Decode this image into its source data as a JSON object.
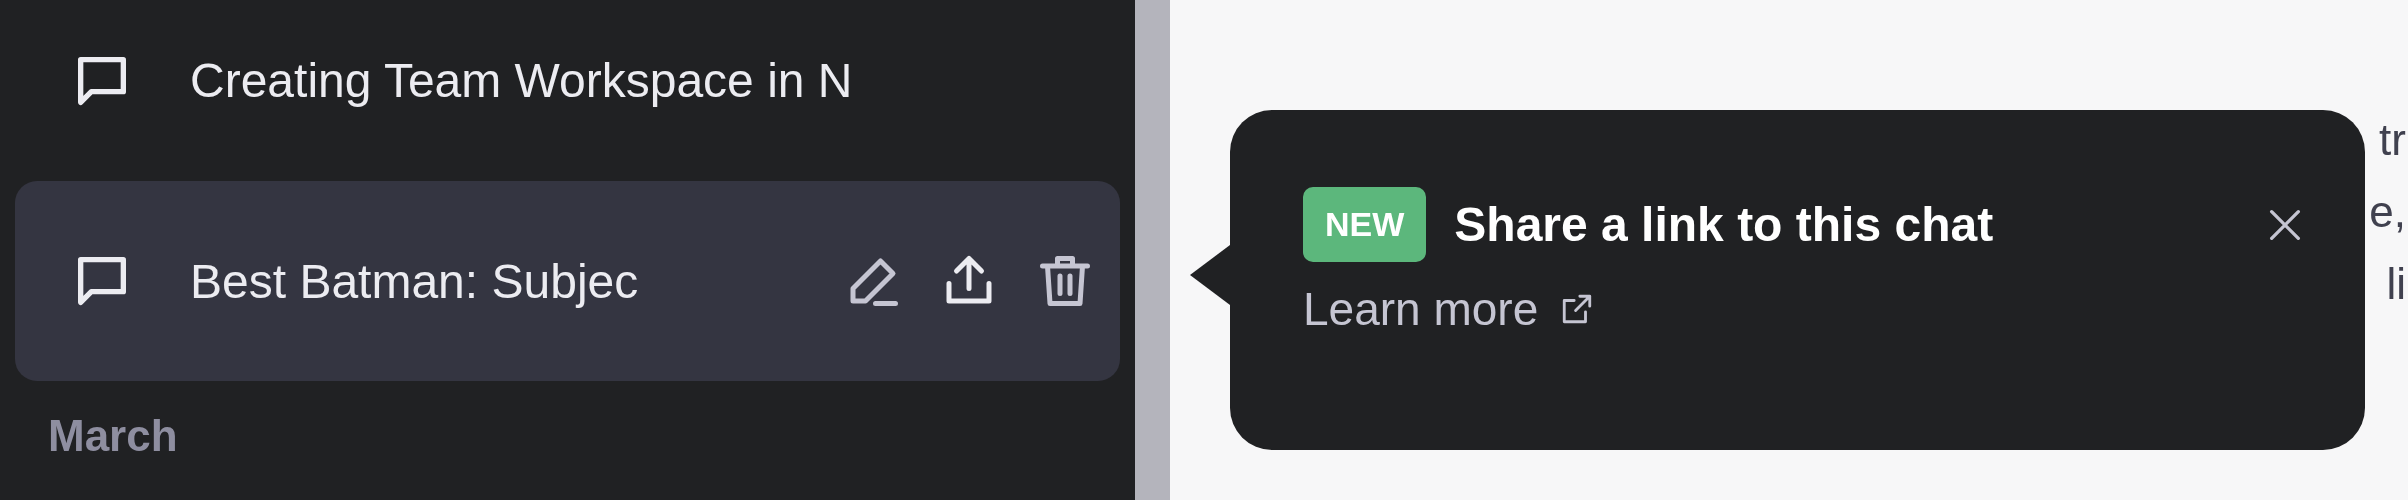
{
  "sidebar": {
    "chats": [
      {
        "title": "Creating Team Workspace in N",
        "selected": false
      },
      {
        "title": "Best Batman: Subjec",
        "selected": true
      }
    ],
    "section_label": "March"
  },
  "main": {
    "text_fragments": [
      "tr",
      "e,",
      "li"
    ]
  },
  "popover": {
    "badge": "NEW",
    "title": "Share a link to this chat",
    "link": "Learn more"
  }
}
